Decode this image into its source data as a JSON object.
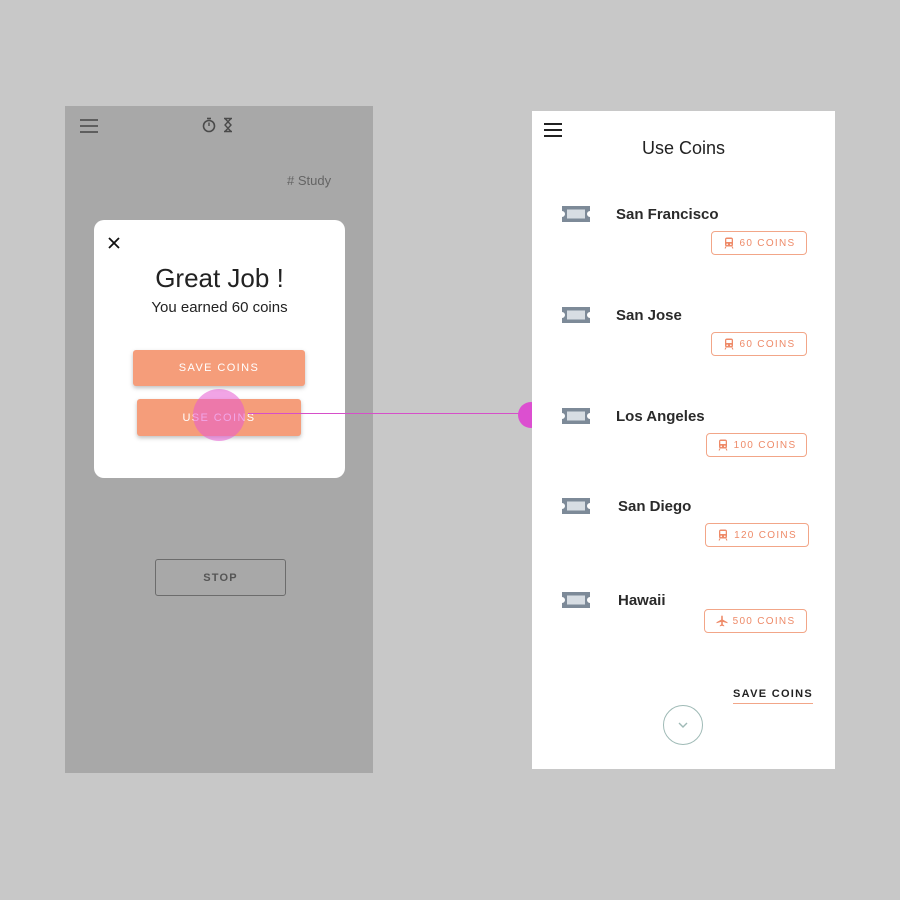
{
  "left_screen": {
    "tag": "# Study",
    "stop_label": "STOP",
    "modal": {
      "title": "Great Job !",
      "subtitle": "You earned 60 coins",
      "save_label": "SAVE COINS",
      "use_label": "USE COINS"
    }
  },
  "right_screen": {
    "title": "Use Coins",
    "destinations": [
      {
        "name": "San Francisco",
        "coins": "60 COINS",
        "transport": "train-icon"
      },
      {
        "name": "San Jose",
        "coins": "60 COINS",
        "transport": "train-icon"
      },
      {
        "name": "Los Angeles",
        "coins": "100 COINS",
        "transport": "train-icon"
      },
      {
        "name": "San Diego",
        "coins": "120 COINS",
        "transport": "train-icon"
      },
      {
        "name": "Hawaii",
        "coins": "500 COINS",
        "transport": "airplane-icon"
      }
    ],
    "save_link": "SAVE COINS"
  },
  "colors": {
    "accent": "#f59d7a",
    "badge_text": "#ee8a68",
    "connector": "#dc4fd0",
    "ticket_icon": "#7d8a98"
  }
}
